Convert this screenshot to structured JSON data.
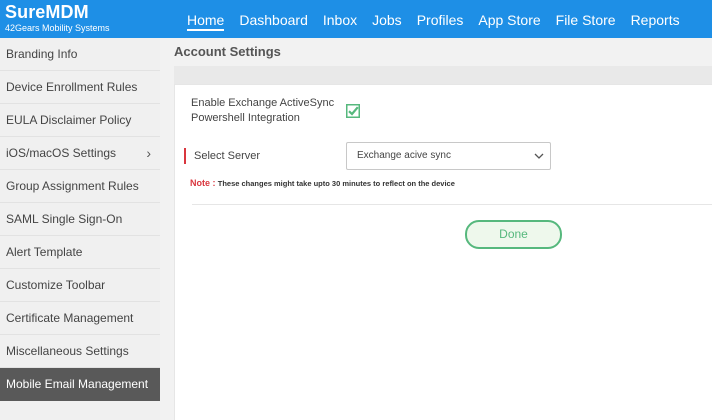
{
  "brand": {
    "title": "SureMDM",
    "subtitle": "42Gears Mobility Systems"
  },
  "nav": [
    {
      "label": "Home",
      "active": true
    },
    {
      "label": "Dashboard"
    },
    {
      "label": "Inbox"
    },
    {
      "label": "Jobs"
    },
    {
      "label": "Profiles"
    },
    {
      "label": "App Store"
    },
    {
      "label": "File Store"
    },
    {
      "label": "Reports"
    }
  ],
  "sidebar": {
    "items": [
      {
        "label": "Branding Info"
      },
      {
        "label": "Device Enrollment Rules"
      },
      {
        "label": "EULA Disclaimer Policy"
      },
      {
        "label": "iOS/macOS Settings",
        "expandable": true
      },
      {
        "label": "Group Assignment Rules"
      },
      {
        "label": "SAML Single Sign-On"
      },
      {
        "label": "Alert Template"
      },
      {
        "label": "Customize Toolbar"
      },
      {
        "label": "Certificate Management"
      },
      {
        "label": "Miscellaneous Settings"
      },
      {
        "label": "Mobile Email Management",
        "active": true
      }
    ]
  },
  "page": {
    "title": "Account Settings"
  },
  "form": {
    "exchange_label": "Enable Exchange ActiveSync Powershell Integration",
    "exchange_checked": true,
    "server_label": "Select Server",
    "server_value": "Exchange acive sync",
    "note_key": "Note :",
    "note_text": "These changes might take upto 30 minutes to reflect on the device",
    "done_label": "Done"
  },
  "colors": {
    "header": "#1e8fe6",
    "accent_green": "#56b87d",
    "required_red": "#d9363e",
    "sidebar_active": "#595959"
  }
}
